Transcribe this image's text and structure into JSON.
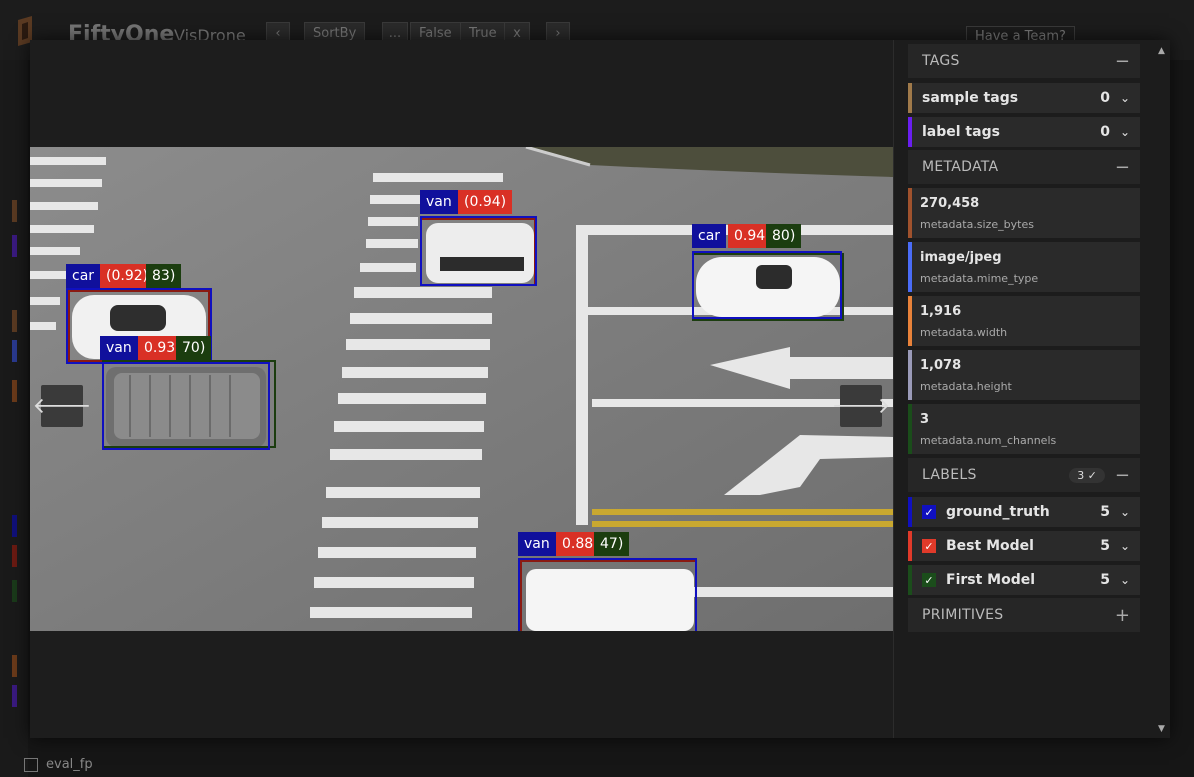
{
  "app": {
    "title": "FiftyOne",
    "dataset": "VisDrone",
    "team_button": "Have a Team?",
    "toolbar": {
      "sort_by": "SortBy",
      "ellipsis": "...",
      "false_label": "False",
      "true_label": "True",
      "close": "x"
    },
    "bottom_item": "eval_fp"
  },
  "modal": {
    "nav_prev_icon": "arrow-left-icon",
    "nav_next_icon": "arrow-right-icon",
    "prev_glyph": "🡐",
    "next_glyph": "🡒",
    "detections": [
      {
        "tags": [
          {
            "text": "car",
            "color": "#10109c"
          },
          {
            "text": "(0.92)",
            "color": "#d93025"
          },
          {
            "text": "83)",
            "color": "#1b3d0f"
          }
        ]
      },
      {
        "tags": [
          {
            "text": "van",
            "color": "#10109c"
          },
          {
            "text": "(0.94)",
            "color": "#d93025"
          }
        ]
      },
      {
        "tags": [
          {
            "text": "car",
            "color": "#10109c"
          },
          {
            "text": "0.94)",
            "color": "#d93025"
          },
          {
            "text": "80)",
            "color": "#1b3d0f"
          }
        ]
      },
      {
        "tags": [
          {
            "text": "van",
            "color": "#10109c"
          },
          {
            "text": "0.93)",
            "color": "#d93025"
          },
          {
            "text": "70)",
            "color": "#1b3d0f"
          }
        ]
      },
      {
        "tags": [
          {
            "text": "van",
            "color": "#10109c"
          },
          {
            "text": "0.88)",
            "color": "#d93025"
          },
          {
            "text": "47)",
            "color": "#1b3d0f"
          }
        ]
      }
    ]
  },
  "sidebar": {
    "tags": {
      "title": "TAGS",
      "toggle": "−",
      "rows": [
        {
          "label": "sample tags",
          "count": "0",
          "color": "#a07a4a"
        },
        {
          "label": "label tags",
          "count": "0",
          "color": "#6a1ef0"
        }
      ]
    },
    "metadata": {
      "title": "METADATA",
      "toggle": "−",
      "items": [
        {
          "value": "270,458",
          "key": "metadata.size_bytes",
          "color": "#a0522d"
        },
        {
          "value": "image/jpeg",
          "key": "metadata.mime_type",
          "color": "#4a6cf7"
        },
        {
          "value": "1,916",
          "key": "metadata.width",
          "color": "#e8823a"
        },
        {
          "value": "1,078",
          "key": "metadata.height",
          "color": "#9a9ab8"
        },
        {
          "value": "3",
          "key": "metadata.num_channels",
          "color": "#1a4d1a"
        }
      ]
    },
    "labels": {
      "title": "LABELS",
      "badge": "3 ✓",
      "toggle": "−",
      "rows": [
        {
          "label": "ground_truth",
          "count": "5",
          "color": "#1010c0",
          "checked": true
        },
        {
          "label": "Best Model",
          "count": "5",
          "color": "#e03a2a",
          "checked": true
        },
        {
          "label": "First Model",
          "count": "5",
          "color": "#1b4d1b",
          "checked": true
        }
      ]
    },
    "primitives": {
      "title": "PRIMITIVES",
      "toggle": "+"
    }
  }
}
